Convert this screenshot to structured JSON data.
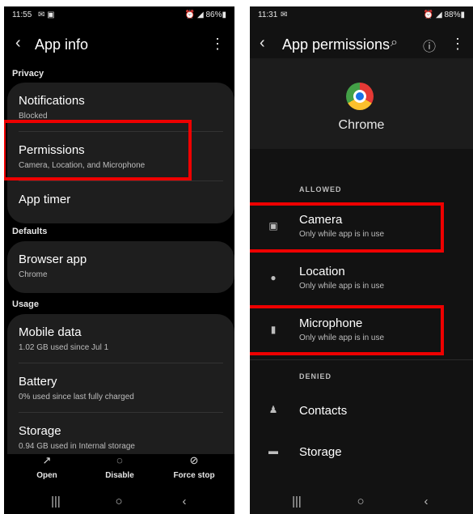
{
  "left": {
    "status": {
      "time": "11:55",
      "left_icons": "✉ ▣",
      "right": "⏰ ◢ 86%▮"
    },
    "appbar": {
      "back": "‹",
      "title": "App info",
      "more": "⋮"
    },
    "sections": {
      "privacy": "Privacy",
      "defaults": "Defaults",
      "usage": "Usage"
    },
    "privacy_items": {
      "notifications": {
        "title": "Notifications",
        "sub": "Blocked"
      },
      "permissions": {
        "title": "Permissions",
        "sub": "Camera, Location, and Microphone"
      },
      "app_timer": {
        "title": "App timer"
      }
    },
    "defaults_items": {
      "browser": {
        "title": "Browser app",
        "sub": "Chrome"
      }
    },
    "usage_items": {
      "mobile_data": {
        "title": "Mobile data",
        "sub": "1.02 GB used since Jul 1"
      },
      "battery": {
        "title": "Battery",
        "sub": "0% used since last fully charged"
      },
      "storage": {
        "title": "Storage",
        "sub": "0.94 GB used in Internal storage"
      }
    },
    "actions": {
      "open": "Open",
      "disable": "Disable",
      "force_stop": "Force stop"
    },
    "action_icons": {
      "open": "↗",
      "disable": "◌",
      "force_stop": "⊘"
    },
    "nav": {
      "recents": "|||",
      "home": "○",
      "back": "‹"
    }
  },
  "right": {
    "status": {
      "time": "11:31",
      "left_icons": "✉",
      "right": "⏰ ◢ 88%▮"
    },
    "appbar": {
      "back": "‹",
      "title": "App permissions",
      "search": "⌕",
      "help": "ⓘ",
      "more": "⋮"
    },
    "app_name": "Chrome",
    "allowed_label": "ALLOWED",
    "denied_label": "DENIED",
    "allowed": {
      "camera": {
        "title": "Camera",
        "sub": "Only while app is in use"
      },
      "location": {
        "title": "Location",
        "sub": "Only while app is in use"
      },
      "microphone": {
        "title": "Microphone",
        "sub": "Only while app is in use"
      }
    },
    "denied": {
      "contacts": {
        "title": "Contacts"
      },
      "storage": {
        "title": "Storage"
      }
    },
    "nav": {
      "recents": "|||",
      "home": "○",
      "back": "‹"
    }
  },
  "colors": {
    "highlight": "#ee0000",
    "background": "#000000",
    "card": "#1e1e1e"
  }
}
